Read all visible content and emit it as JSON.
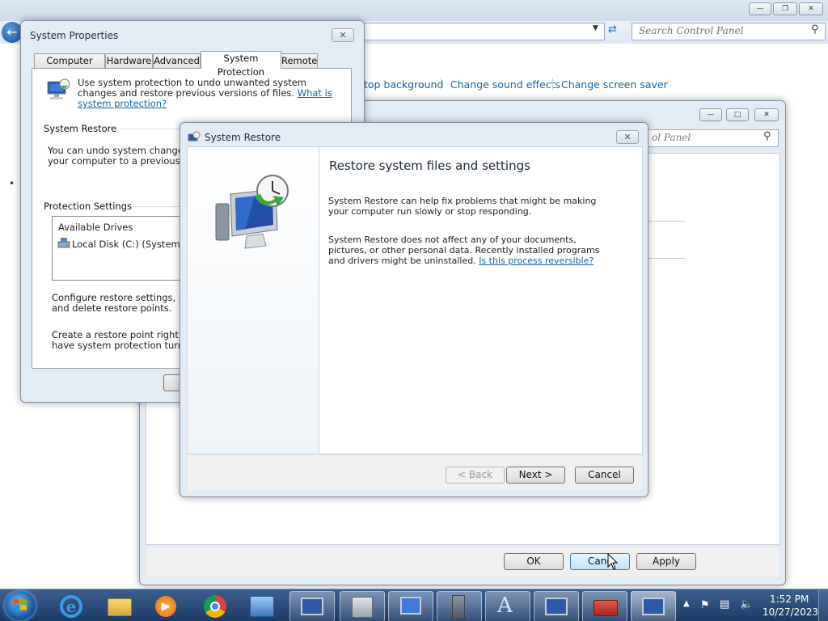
{
  "control_panel": {
    "search_placeholder": "Search Control Panel",
    "links": [
      "top background",
      "Change sound effects",
      "Change screen saver"
    ]
  },
  "back_window": {
    "search_placeholder": "ol Panel",
    "buttons": {
      "ok": "OK",
      "cancel": "Canc",
      "apply": "Apply"
    }
  },
  "system_properties": {
    "title": "System Properties",
    "tabs": [
      "Computer Name",
      "Hardware",
      "Advanced",
      "System Protection",
      "Remote"
    ],
    "intro_text": "Use system protection to undo unwanted system changes and restore previous versions of files.",
    "intro_link": "What is system protection?",
    "system_restore_heading": "System Restore",
    "system_restore_text_1": "You can undo system changes by r",
    "system_restore_text_2": "your computer to a previous restore",
    "protection_settings_heading": "Protection Settings",
    "drives_header": "Available Drives",
    "drive_item": "Local Disk (C:) (System)",
    "configure_text_1": "Configure restore settings, manag",
    "configure_text_2": "and delete restore points.",
    "create_text_1": "Create a restore point right now fo",
    "create_text_2": "have system protection turned on"
  },
  "system_restore": {
    "title": "System Restore",
    "heading": "Restore system files and settings",
    "para1": "System Restore can help fix problems that might be making your computer run slowly or stop responding.",
    "para2": "System Restore does not affect any of your documents, pictures, or other personal data. Recently installed programs and drivers might be uninstalled.",
    "para2_link": "Is this process reversible?",
    "buttons": {
      "back": "< Back",
      "next": "Next >",
      "cancel": "Cancel"
    }
  },
  "taskbar": {
    "time": "1:52 PM",
    "date": "10/27/2023"
  },
  "colors": {
    "taskbar": "#1c3c66",
    "link": "#1464a5",
    "frame": "#e3ebf4"
  }
}
